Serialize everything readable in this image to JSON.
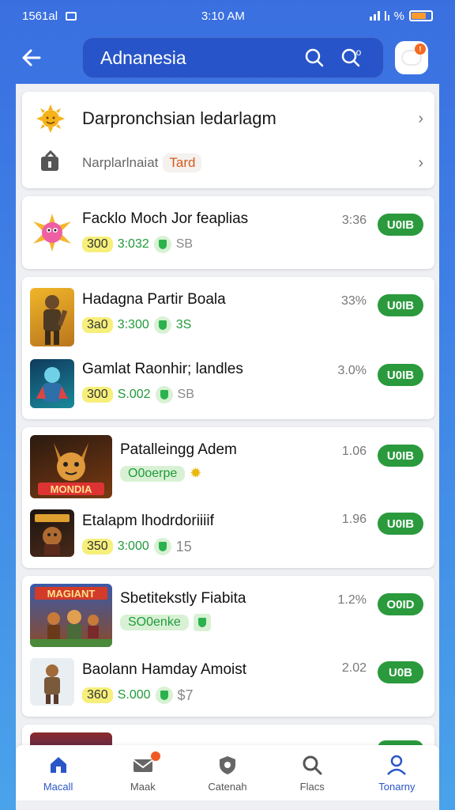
{
  "status": {
    "left_text": "1561al",
    "time": "3:10 AM",
    "right_text": "%"
  },
  "header": {
    "search_value": "Adnanesia",
    "search_icon_badge": "o"
  },
  "featured": {
    "title": "Darpronchsian ledarlagm",
    "row2_text": "Narplarlnaiat",
    "row2_tag": "Tard"
  },
  "apps": [
    {
      "title": "Facklo Moch Jor feaplias",
      "rating": "300",
      "score": "3:032",
      "extra": "SB",
      "size": "3:36",
      "button": "U0IB"
    },
    {
      "title": "Hadagna Partir Boala",
      "rating": "3a0",
      "score": "3:300",
      "extra": "3S",
      "size": "33%",
      "button": "U0IB"
    },
    {
      "title": "Gamlat Raonhir; landles",
      "rating": "300",
      "score": "S.002",
      "extra": "SB",
      "size": "3.0%",
      "button": "U0IB"
    },
    {
      "title": "Patalleingg Adem",
      "green_chip": "O0oerpe",
      "size": "1.06",
      "button": "U0IB",
      "thumb_label": "MONDIA"
    },
    {
      "title": "Etalapm lhodrdoriiiif",
      "rating": "350",
      "score": "3:000",
      "extra": "15",
      "size": "1.96",
      "button": "U0IB"
    },
    {
      "title": "Sbetitekstly Fiabita",
      "green_chip": "SO0enke",
      "size": "1.2%",
      "button": "O0ID",
      "thumb_label": "MAGIANT"
    },
    {
      "title": "Baolann Hamday Amoist",
      "rating": "360",
      "score": "S.000",
      "extra": "$7",
      "size": "2.02",
      "button": "U0B"
    }
  ],
  "bottom_nav": [
    {
      "label": "Macall"
    },
    {
      "label": "Maak"
    },
    {
      "label": "Catenah"
    },
    {
      "label": "Flacs"
    },
    {
      "label": "Tonarny"
    }
  ],
  "colors": {
    "accent_blue": "#2a56c8",
    "get_green": "#2a9a3d",
    "header_bg": "#3a6fe0"
  }
}
